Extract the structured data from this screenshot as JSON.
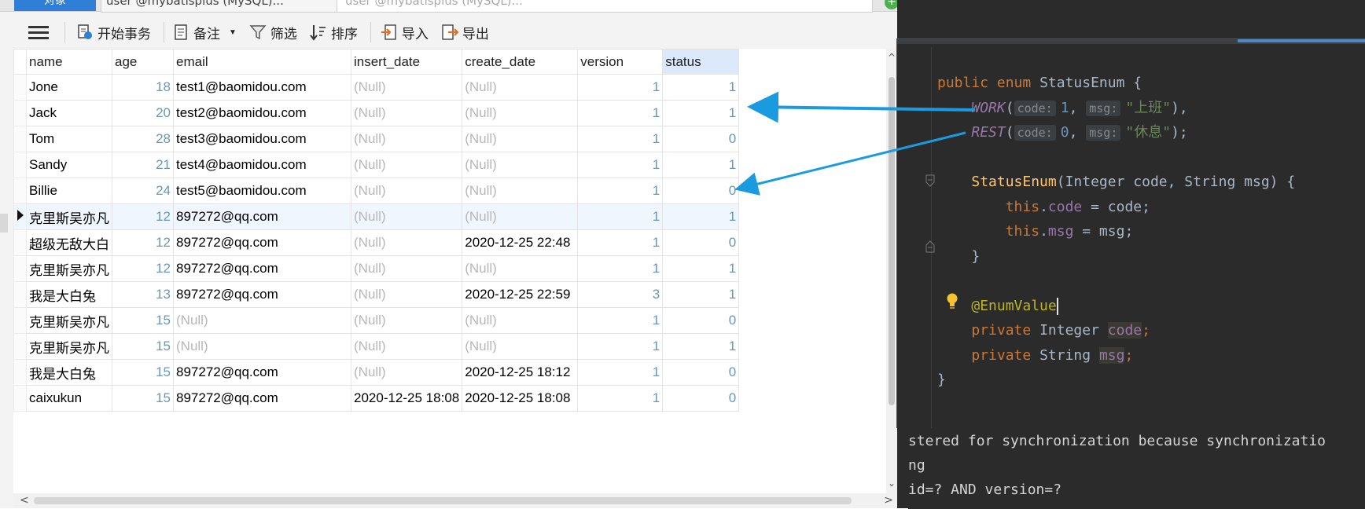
{
  "tabs": {
    "objects_label": "对象",
    "doc1": "user @mybatisplus (MySQL)...",
    "doc2": "user @mybatisplus (MySQL)..."
  },
  "toolbar": {
    "begin_transaction": "开始事务",
    "memo": "备注",
    "filter": "筛选",
    "sort": "排序",
    "import": "导入",
    "export": "导出"
  },
  "grid": {
    "columns": [
      "name",
      "age",
      "email",
      "insert_date",
      "create_date",
      "version",
      "status"
    ],
    "rows": [
      [
        "Jone",
        "18",
        "test1@baomidou.com",
        "(Null)",
        "(Null)",
        "1",
        "1"
      ],
      [
        "Jack",
        "20",
        "test2@baomidou.com",
        "(Null)",
        "(Null)",
        "1",
        "1"
      ],
      [
        "Tom",
        "28",
        "test3@baomidou.com",
        "(Null)",
        "(Null)",
        "1",
        "0"
      ],
      [
        "Sandy",
        "21",
        "test4@baomidou.com",
        "(Null)",
        "(Null)",
        "1",
        "1"
      ],
      [
        "Billie",
        "24",
        "test5@baomidou.com",
        "(Null)",
        "(Null)",
        "1",
        "0"
      ],
      [
        "克里斯吴亦凡",
        "12",
        "897272@qq.com",
        "(Null)",
        "(Null)",
        "1",
        "1"
      ],
      [
        "超级无敌大白",
        "12",
        "897272@qq.com",
        "(Null)",
        "2020-12-25 22:48",
        "1",
        "0"
      ],
      [
        "克里斯吴亦凡",
        "12",
        "897272@qq.com",
        "(Null)",
        "(Null)",
        "1",
        "1"
      ],
      [
        "我是大白兔",
        "13",
        "897272@qq.com",
        "(Null)",
        "2020-12-25 22:59",
        "3",
        "1"
      ],
      [
        "克里斯吴亦凡",
        "15",
        "(Null)",
        "(Null)",
        "(Null)",
        "1",
        "0"
      ],
      [
        "克里斯吴亦凡",
        "15",
        "(Null)",
        "(Null)",
        "(Null)",
        "1",
        "1"
      ],
      [
        "我是大白兔",
        "15",
        "897272@qq.com",
        "(Null)",
        "2020-12-25 18:12",
        "1",
        "0"
      ],
      [
        "caixukun",
        "15",
        "897272@qq.com",
        "2020-12-25 18:08",
        "2020-12-25 18:08",
        "1",
        "0"
      ]
    ],
    "current_row": 5,
    "selected_column": "status"
  },
  "code": {
    "public": "public",
    "enum": "enum",
    "enum_name": "StatusEnum",
    "work": "WORK",
    "rest": "REST",
    "hint_code": "code:",
    "hint_msg": "msg:",
    "work_code": "1",
    "rest_code": "0",
    "work_msg": "\"上班\"",
    "rest_msg": "\"休息\"",
    "ctor_name": "StatusEnum",
    "ctor_params": "(Integer code, String msg) {",
    "this": "this",
    "code_field": "code",
    "msg_field": "msg",
    "assign_code": " = code;",
    "assign_msg": " = msg;",
    "annotation": "@EnumValue",
    "private": "private",
    "integer_type": "Integer",
    "string_type": "String"
  },
  "console": [
    "stered for synchronization because synchronizatio",
    "ng",
    "id=? AND version=?"
  ],
  "colors": {
    "accent_blue": "#2f7fd6",
    "arrow_blue": "#1a9be0",
    "ide_bg": "#2b2b2b"
  }
}
